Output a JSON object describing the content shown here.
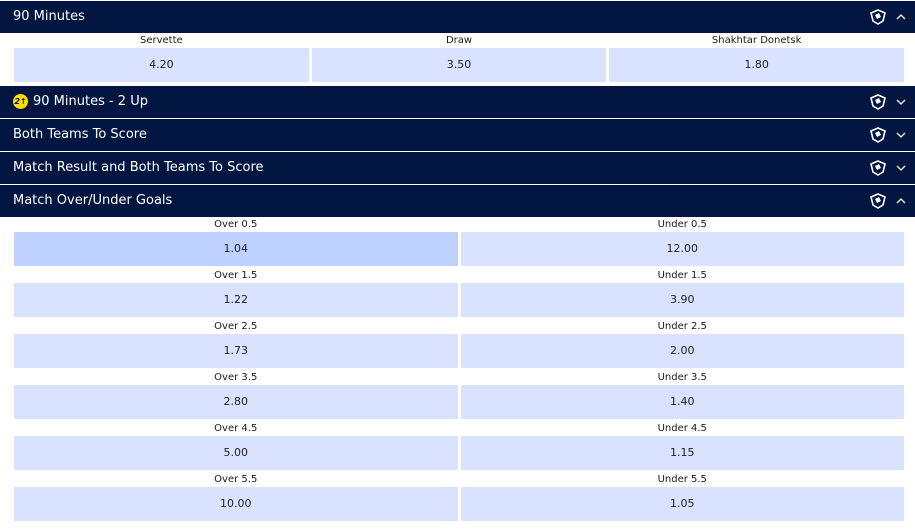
{
  "markets": {
    "ninety": {
      "title": "90 Minutes",
      "outcomes": [
        {
          "label": "Servette",
          "odd": "4.20"
        },
        {
          "label": "Draw",
          "odd": "3.50"
        },
        {
          "label": "Shakhtar Donetsk",
          "odd": "1.80"
        }
      ]
    },
    "two_up": {
      "title": "90 Minutes - 2 Up",
      "badge": "2↑"
    },
    "btts": {
      "title": "Both Teams To Score"
    },
    "result_btts": {
      "title": "Match Result and Both Teams To Score"
    },
    "over_under": {
      "title": "Match Over/Under Goals",
      "rows": [
        {
          "over_label": "Over 0.5",
          "over_odd": "1.04",
          "under_label": "Under 0.5",
          "under_odd": "12.00"
        },
        {
          "over_label": "Over 1.5",
          "over_odd": "1.22",
          "under_label": "Under 1.5",
          "under_odd": "3.90"
        },
        {
          "over_label": "Over 2.5",
          "over_odd": "1.73",
          "under_label": "Under 2.5",
          "under_odd": "2.00"
        },
        {
          "over_label": "Over 3.5",
          "over_odd": "2.80",
          "under_label": "Under 3.5",
          "under_odd": "1.40"
        },
        {
          "over_label": "Over 4.5",
          "over_odd": "5.00",
          "under_label": "Under 4.5",
          "under_odd": "1.15"
        },
        {
          "over_label": "Over 5.5",
          "over_odd": "10.00",
          "under_label": "Under 5.5",
          "under_odd": "1.05"
        }
      ]
    }
  },
  "icons": {
    "same_game_multi": "same-game-multi-icon",
    "collapse": "chevron-up-icon",
    "expand": "chevron-down-icon"
  },
  "colors": {
    "header_bg": "#021641",
    "odd_bg": "#d9e3ff",
    "odd_selected_bg": "#bfd2ff",
    "badge_bg": "#ffde00"
  }
}
